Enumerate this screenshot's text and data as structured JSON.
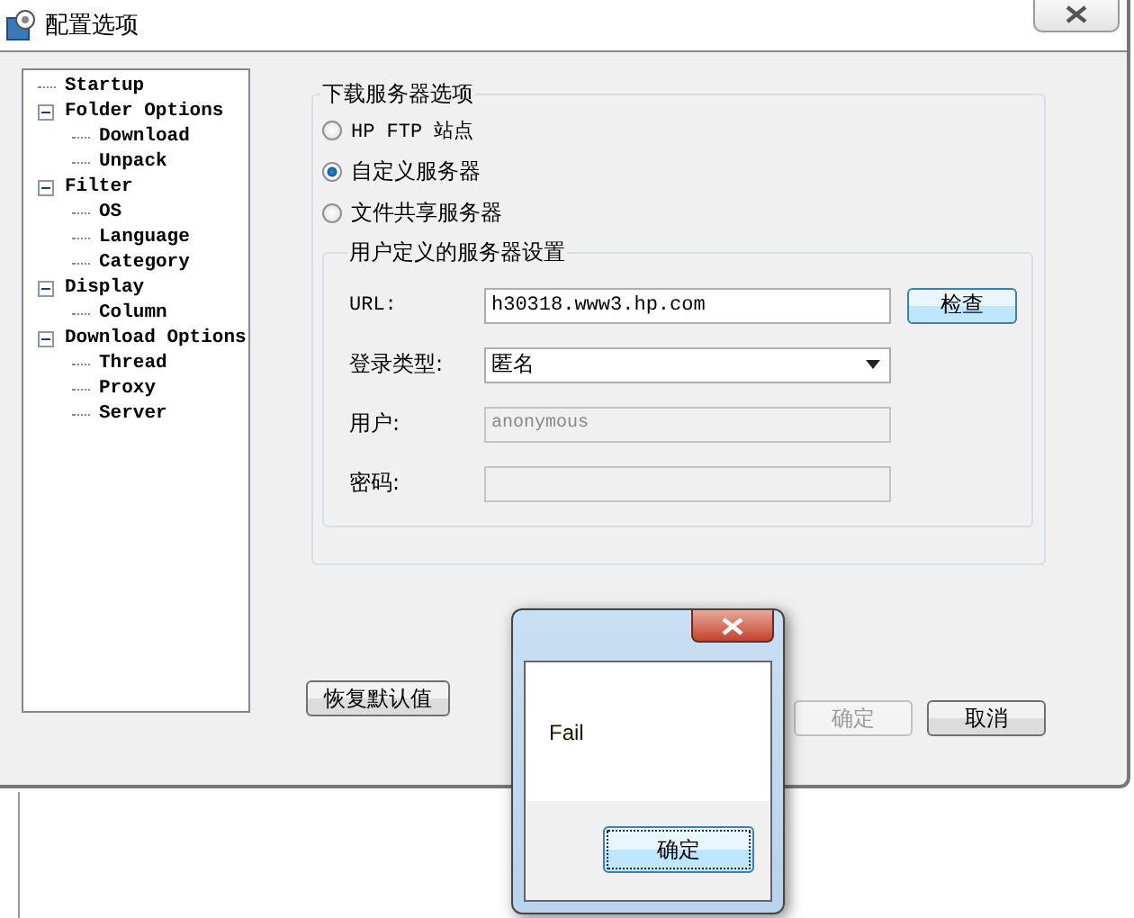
{
  "window": {
    "title": "配置选项"
  },
  "tree": [
    {
      "label": "Startup"
    },
    {
      "label": "Folder Options",
      "expanded": true,
      "children": [
        {
          "label": "Download"
        },
        {
          "label": "Unpack"
        }
      ]
    },
    {
      "label": "Filter",
      "expanded": true,
      "children": [
        {
          "label": "OS"
        },
        {
          "label": "Language"
        },
        {
          "label": "Category"
        }
      ]
    },
    {
      "label": "Display",
      "expanded": true,
      "children": [
        {
          "label": "Column"
        }
      ]
    },
    {
      "label": "Download Options",
      "expanded": true,
      "children": [
        {
          "label": "Thread"
        },
        {
          "label": "Proxy"
        },
        {
          "label": "Server"
        }
      ]
    }
  ],
  "server_group": {
    "title": "下载服务器选项",
    "radios": [
      {
        "label": "HP FTP 站点",
        "selected": false
      },
      {
        "label": "自定义服务器",
        "selected": true
      },
      {
        "label": "文件共享服务器",
        "selected": false
      }
    ],
    "custom_group": {
      "title": "用户定义的服务器设置",
      "url": {
        "label": "URL:",
        "value": "h30318.www3.hp.com",
        "button": "检查"
      },
      "login_type": {
        "label": "登录类型:",
        "value": "匿名"
      },
      "user": {
        "label": "用户:",
        "value": "anonymous",
        "disabled": true
      },
      "password": {
        "label": "密码:",
        "disabled": true
      }
    }
  },
  "buttons": [
    {
      "label": "恢复默认值",
      "disabled": false
    },
    {
      "label": "确定",
      "disabled": true
    },
    {
      "label": "取消",
      "disabled": false
    }
  ],
  "message_box": {
    "text": "Fail",
    "button": "确定"
  }
}
